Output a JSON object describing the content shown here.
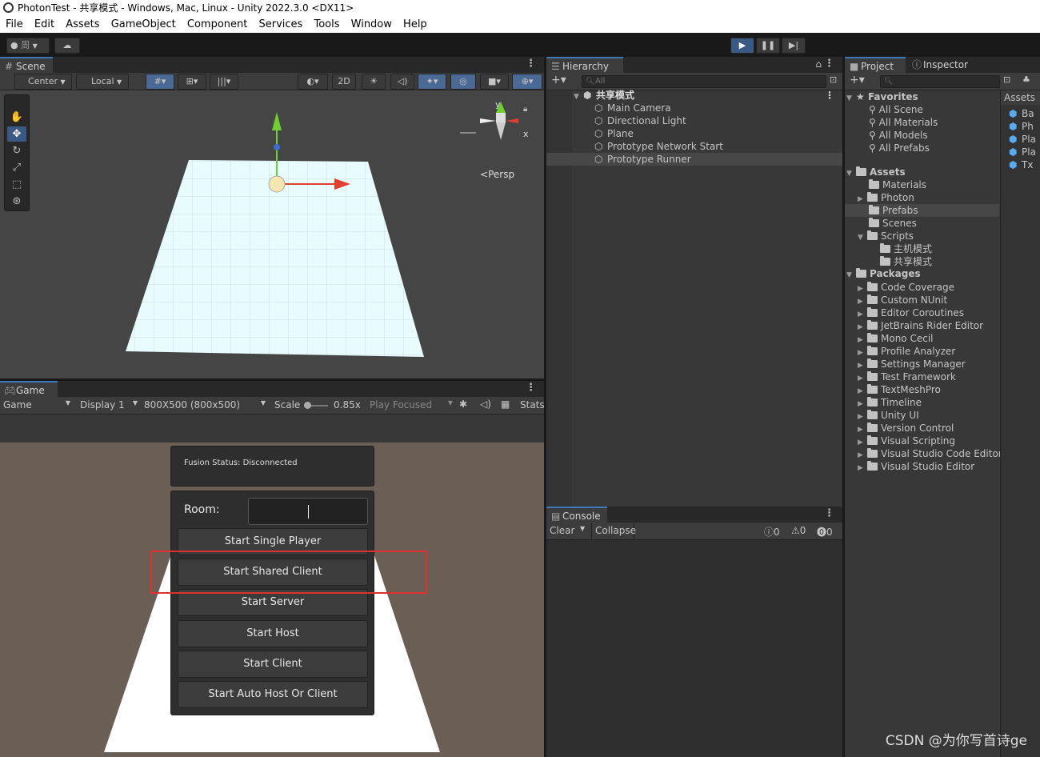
{
  "window": {
    "title": "PhotonTest - 共享模式 - Windows, Mac, Linux - Unity 2022.3.0 <DX11>"
  },
  "menu": [
    "File",
    "Edit",
    "Assets",
    "GameObject",
    "Component",
    "Services",
    "Tools",
    "Window",
    "Help"
  ],
  "toolbar": {
    "account_label": "周"
  },
  "scene": {
    "tab": "Scene",
    "pivot": "Center",
    "space": "Local",
    "mode_2d": "2D",
    "persp": "Persp",
    "gizmo_y": "y",
    "gizmo_x": "x"
  },
  "game": {
    "tab": "Game",
    "view": "Game",
    "display": "Display 1",
    "resolution": "800X500 (800x500)",
    "scale_label": "Scale",
    "scale_value": "0.85x",
    "play_focused": "Play Focused",
    "stats": "Stats",
    "status": "Fusion Status: Disconnected",
    "room_label": "Room:",
    "buttons": [
      "Start Single Player",
      "Start Shared Client",
      "Start Server",
      "Start Host",
      "Start Client",
      "Start Auto Host Or Client"
    ]
  },
  "hierarchy": {
    "tab": "Hierarchy",
    "search_placeholder": "All",
    "root": "共享模式",
    "items": [
      "Main Camera",
      "Directional Light",
      "Plane",
      "Prototype Network Start",
      "Prototype Runner"
    ]
  },
  "console": {
    "tab": "Console",
    "clear": "Clear",
    "collapse": "Collapse",
    "info_count": "0",
    "warn_count": "0",
    "error_count": "0"
  },
  "project": {
    "tab_project": "Project",
    "tab_inspector": "Inspector",
    "favorites": {
      "label": "Favorites",
      "items": [
        "All Scene",
        "All Materials",
        "All Models",
        "All Prefabs"
      ]
    },
    "assets": {
      "label": "Assets",
      "items": [
        "Materials",
        "Photon",
        "Prefabs",
        "Scenes",
        "Scripts",
        "主机模式",
        "共享模式"
      ]
    },
    "packages": {
      "label": "Packages",
      "items": [
        "Code Coverage",
        "Custom NUnit",
        "Editor Coroutines",
        "JetBrains Rider Editor",
        "Mono Cecil",
        "Profile Analyzer",
        "Settings Manager",
        "Test Framework",
        "TextMeshPro",
        "Timeline",
        "Unity UI",
        "Version Control",
        "Visual Scripting",
        "Visual Studio Code Editor",
        "Visual Studio Editor"
      ]
    },
    "assets_header": "Assets",
    "asset_files": [
      "Ba",
      "Ph",
      "Pla",
      "Pla",
      "Tx"
    ]
  },
  "watermark": "CSDN @为你写首诗ge",
  "colors": {
    "highlight_box": "#e03030",
    "accent": "#3a79bb",
    "selection": "#4d4d4d"
  }
}
